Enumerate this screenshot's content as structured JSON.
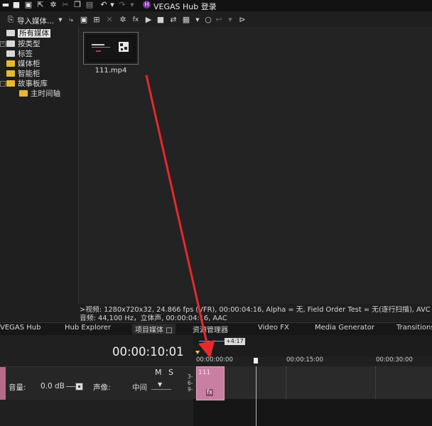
{
  "hub": {
    "badge": "H",
    "title": "VEGAS Hub 登录"
  },
  "toolbar": {
    "import_label": "导入媒体..."
  },
  "tree": {
    "items": [
      {
        "label": "所有媒体",
        "selected": true
      },
      {
        "label": "按类型"
      },
      {
        "label": "标签"
      },
      {
        "label": "媒体柜"
      },
      {
        "label": "智能柜"
      },
      {
        "label": "故事板库"
      },
      {
        "label": "主时间轴"
      }
    ]
  },
  "media": {
    "clip_name": "111.mp4"
  },
  "info": {
    "video": ">视频: 1280x720x32, 24.866 fps (VFR), 00:00:04:16, Alpha = 无, Field Order Test = 无(逐行扫描), AVC",
    "audio": "音频: 44,100 Hz，立体声, 00:00:04:16, AAC"
  },
  "tabs": [
    "VEGAS Hub",
    "Hub Explorer",
    "项目媒体",
    "资源管理器",
    "Video FX",
    "Media Generator",
    "Transitions"
  ],
  "tabs_close_glyph": "□",
  "lower": {
    "timecode": "00:00:10:01",
    "mute": "M",
    "solo": "S",
    "volume_label": "音量:",
    "volume_value": "0.0 dB",
    "pan_label": "声像:",
    "pan_value": "中间"
  },
  "timeline": {
    "selection_badge": "+4:17",
    "ruler": [
      "00:00:00:00",
      "00:00:15:00",
      "00:00:30:00"
    ],
    "clip_title": "111",
    "clip_fx": "fx",
    "row_numbers": [
      "3-",
      "6-",
      "9-"
    ]
  },
  "colors": {
    "accent_arrow": "#e8282a",
    "clip": "#c87fa2",
    "hub_badge": "#7a2fa8"
  }
}
